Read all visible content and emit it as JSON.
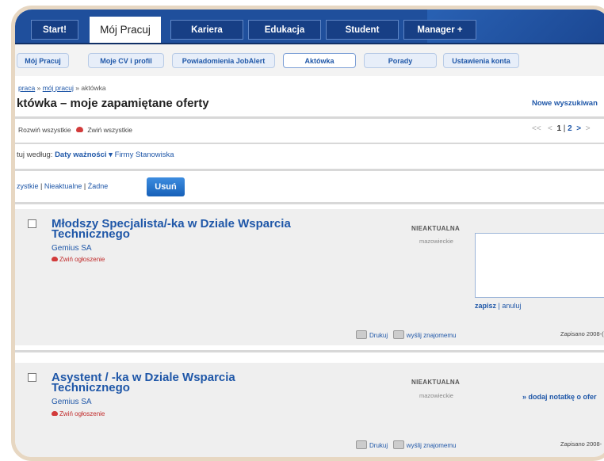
{
  "tabs": [
    "Start!",
    "Mój Pracuj",
    "Kariera",
    "Edukacja",
    "Student",
    "Manager +"
  ],
  "subnav": [
    "Mój Pracuj",
    "Moje CV i profil",
    "Powiadomienia JobAlert",
    "Aktówka",
    "Porady",
    "Ustawienia konta"
  ],
  "breadcrumb": {
    "root": "praca",
    "sep1": " » ",
    "link": "mój pracuj",
    "sep2": " » ",
    "current": "aktówka"
  },
  "page_title": "któwka – moje zapamiętane oferty",
  "new_search": "Nowe wyszukiwan",
  "expand_all": "Rozwiń wszystkie",
  "collapse_all": "Zwiń wszystkie",
  "pager": {
    "prev2": "<<",
    "prev": "<",
    "current": "1",
    "sep": "|",
    "next_page": "2",
    "next": ">",
    "more": ">"
  },
  "sort": {
    "label": "tuj według:",
    "selected": "Daty ważności ▾",
    "option1": "Firmy",
    "option2": "Stanowiska"
  },
  "select": {
    "all": "zystkie",
    "sep": " | ",
    "inactive": "Nieaktualne",
    "none": "Żadne"
  },
  "delete_button": "Usuń",
  "offers": [
    {
      "title_line1": "Młodszy Specjalista/-ka w Dziale Wsparcia",
      "title_line2": "Technicznego",
      "company": "Gemius SA",
      "collapse": "Zwiń ogłoszenie",
      "status": "NIEAKTUALNA",
      "region": "mazowieckie",
      "note_save": "zapisz",
      "note_sep": " | ",
      "note_cancel": "anuluj",
      "print": "Drukuj",
      "send": "wyślij znajomemu",
      "saved": "Zapisano 2008-("
    },
    {
      "title_line1": "Asystent / -ka w Dziale Wsparcia",
      "title_line2": "Technicznego",
      "company": "Gemius SA",
      "collapse": "Zwiń ogłoszenie",
      "status": "NIEAKTUALNA",
      "region": "mazowieckie",
      "add_note": "» dodaj notatkę o ofer",
      "print": "Drukuj",
      "send": "wyślij znajomemu",
      "saved": "Zapisano 2008-"
    }
  ]
}
